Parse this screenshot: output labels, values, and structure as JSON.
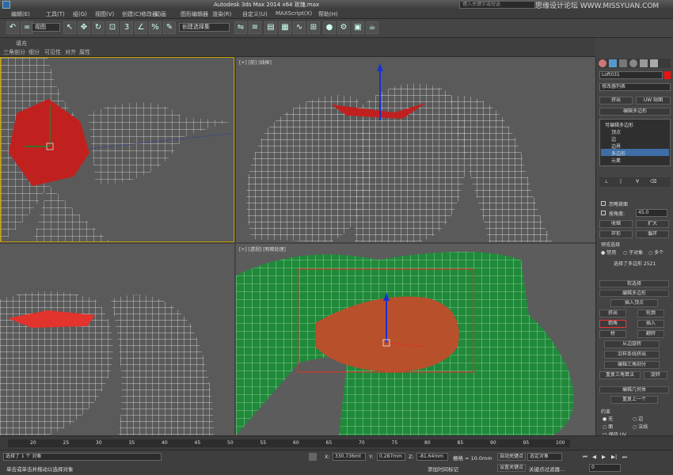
{
  "window": {
    "title": "Autodesk 3ds Max  2014 x64     玫瑰.max",
    "search_placeholder": "键入关键字或短语",
    "watermark": "思缘设计论坛 WWW.MISSYUAN.COM"
  },
  "menu": {
    "items": [
      "编辑(E)",
      "工具(T)",
      "组(G)",
      "视图(V)",
      "创建(C)",
      "修改器",
      "动画",
      "图形编辑器",
      "渲染(R)",
      "自定义(U)",
      "MAXScript(X)",
      "帮助(H)"
    ]
  },
  "toolbar": {
    "view_dropdown": "视图",
    "selection_set": "创建选择集"
  },
  "ribbon": {
    "label_top": "填充",
    "tabs": [
      "三角剖分",
      "细分",
      "可见性",
      "对齐",
      "属性"
    ]
  },
  "viewports": {
    "top_right_label": "[+] [前] [线框]",
    "bottom_right_label": "[+] [透视] [明暗处理]"
  },
  "command_panel": {
    "object_name": "Loft031",
    "modifier_list": "修改器列表",
    "buttons_row1": [
      "挤出",
      "UW 贴图"
    ],
    "button_poly": "编辑多边形",
    "stack": [
      "可编辑多边形",
      "顶点",
      "边",
      "边界",
      "多边形",
      "元素"
    ],
    "ignore_backface": "忽略背面",
    "angle_label": "按角度:",
    "angle_value": "45.0",
    "shrink": "收缩",
    "grow": "扩大",
    "ring": "环形",
    "loop": "循环",
    "preview_selection": "预览选择",
    "preview_options": [
      "禁用",
      "子对象",
      "多个"
    ],
    "selected_info": "选择了多边形 2521",
    "soft_selection": "软选择",
    "edit_polygons": "编辑多边形",
    "insert_vertex": "插入顶点",
    "extrude": "挤出",
    "outline": "轮廓",
    "bevel": "倒角",
    "inset": "插入",
    "bridge": "桥",
    "flip": "翻转",
    "hinge": "从边旋转",
    "extrude_spline": "沿样条线挤出",
    "edit_triangulation": "编辑三角剖分",
    "retriangulate": "重复三角算法",
    "turn": "旋转",
    "edit_geometry": "编辑几何体",
    "repeat_last": "重复上一个",
    "constraints": "约束",
    "constraint_options": [
      "无",
      "边",
      "面",
      "法线"
    ],
    "preserve_uv": "保持 UV"
  },
  "timeline": {
    "ticks": [
      "20",
      "25",
      "30",
      "35",
      "40",
      "45",
      "50",
      "55",
      "60",
      "65",
      "70",
      "75",
      "80",
      "85",
      "90",
      "95",
      "100"
    ]
  },
  "status": {
    "selection_msg": "选择了 1 个 对象",
    "prompt_msg": "单击或单击并拖动以选择对象",
    "x_value": "330.736mt",
    "y_value": "0.287mm",
    "z_value": "-81.64mm",
    "grid": "栅格 = 10.0mm",
    "auto_key": "自动关键点",
    "set_key": "设置关键点",
    "selected_dropdown": "选定对象",
    "add_time_tag": "添加时间标记",
    "key_filters": "关键点过滤器...",
    "frame_value": "0"
  },
  "colors": {
    "wire_bg": "#5a5a5a",
    "selected_poly": "#c0211f",
    "shaded_green": "#1f8a3a",
    "shaded_poly": "#b8502c"
  }
}
